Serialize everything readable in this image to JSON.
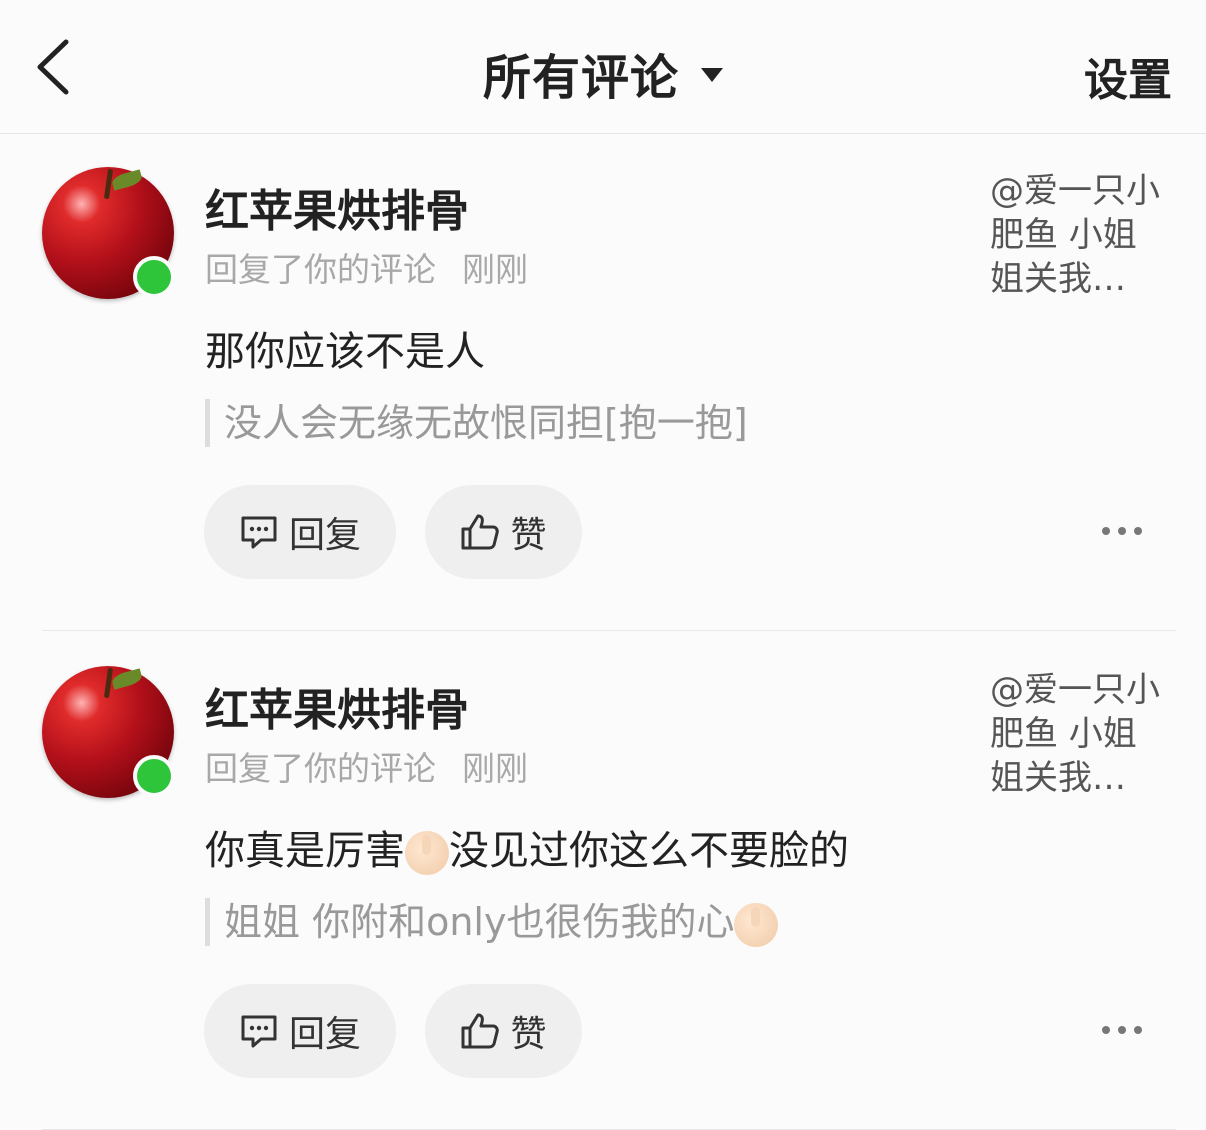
{
  "header": {
    "title": "所有评论",
    "settings_label": "设置"
  },
  "comments": [
    {
      "username": "红苹果烘排骨",
      "action": "回复了你的评论",
      "time": "刚刚",
      "reference_text": "@爱一只小肥鱼 小姐姐关我…",
      "content_before_emoji": "那你应该不是人",
      "content_after_emoji": "",
      "quote_before_emoji": "没人会无缘无故恨同担[抱一抱]",
      "reply_label": "回复",
      "like_label": "赞"
    },
    {
      "username": "红苹果烘排骨",
      "action": "回复了你的评论",
      "time": "刚刚",
      "reference_text": "@爱一只小肥鱼 小姐姐关我…",
      "content_before_emoji": "你真是厉害",
      "content_after_emoji": "没见过你这么不要脸的",
      "quote_before_emoji": "姐姐 你附和only也很伤我的心",
      "reply_label": "回复",
      "like_label": "赞"
    }
  ]
}
